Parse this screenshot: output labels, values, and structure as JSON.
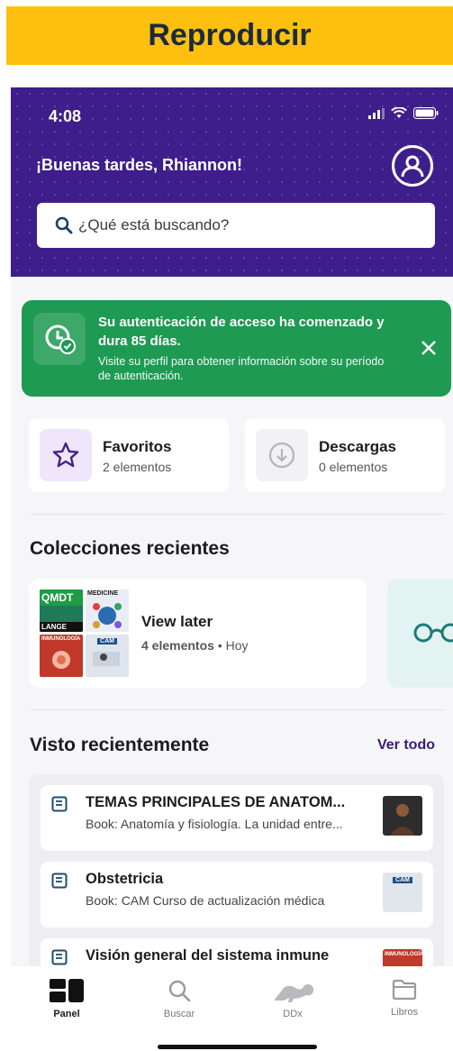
{
  "banner": {
    "label": "Reproducir",
    "color": "#fdc00f"
  },
  "status_bar": {
    "time": "4:08"
  },
  "header": {
    "greeting": "¡Buenas tardes, Rhiannon!",
    "search_placeholder": "¿Qué está buscando?",
    "background": "#3d1e8a"
  },
  "notification": {
    "title": "Su autenticación de acceso ha comenzado y dura 85 días.",
    "body": "Visite su perfil para obtener información sobre su período de autenticación.",
    "color": "#1e9a52"
  },
  "quick_links": [
    {
      "title": "Favoritos",
      "subtitle": "2 elementos",
      "icon": "star-icon"
    },
    {
      "title": "Descargas",
      "subtitle": "0 elementos",
      "icon": "download-icon"
    }
  ],
  "collections": {
    "title": "Colecciones recientes",
    "items": [
      {
        "name": "View later",
        "count": "4 elementos",
        "separator": "•",
        "when": "Hoy",
        "thumbs": [
          "QMDT",
          "MEDICINE",
          "INMUNOLOGÍA",
          "CAM"
        ],
        "thumb_sub": "LANGE"
      }
    ]
  },
  "recent": {
    "title": "Visto recientemente",
    "see_all": "Ver todo",
    "items": [
      {
        "title": "TEMAS PRINCIPALES DE ANATOM...",
        "subtitle": "Book: Anatomía y fisiología. La unidad entre..."
      },
      {
        "title": "Obstetricia",
        "subtitle": "Book: CAM Curso de actualización médica",
        "thumb_label": "CAM"
      },
      {
        "title": "Visión general del sistema inmune",
        "subtitle": "",
        "thumb_label": "INMUNOLOGÍA"
      }
    ]
  },
  "tabbar": {
    "tabs": [
      {
        "label": "Panel",
        "icon": "dashboard-icon",
        "active": true
      },
      {
        "label": "Buscar",
        "icon": "search-icon",
        "active": false
      },
      {
        "label": "DDx",
        "icon": "dinosaur-icon",
        "active": false
      },
      {
        "label": "Libros",
        "icon": "folder-icon",
        "active": false
      }
    ]
  },
  "accent": "#3b1a7a"
}
